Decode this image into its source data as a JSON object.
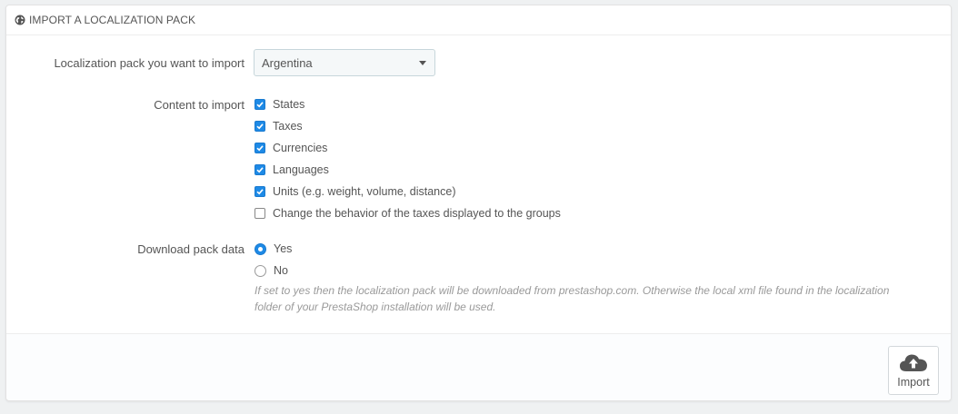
{
  "panel": {
    "title": "IMPORT A LOCALIZATION PACK",
    "icon": "globe-icon"
  },
  "pack_select": {
    "label": "Localization pack you want to import",
    "value": "Argentina"
  },
  "content": {
    "label": "Content to import",
    "items": [
      {
        "label": "States",
        "checked": true
      },
      {
        "label": "Taxes",
        "checked": true
      },
      {
        "label": "Currencies",
        "checked": true
      },
      {
        "label": "Languages",
        "checked": true
      },
      {
        "label": "Units (e.g. weight, volume, distance)",
        "checked": true
      },
      {
        "label": "Change the behavior of the taxes displayed to the groups",
        "checked": false
      }
    ]
  },
  "download": {
    "label": "Download pack data",
    "options": [
      {
        "label": "Yes",
        "selected": true
      },
      {
        "label": "No",
        "selected": false
      }
    ],
    "help_line1": "If set to yes then the localization pack will be downloaded from prestashop.com. Otherwise the local xml file found in the localization",
    "help_line2": "folder of your PrestaShop installation will be used."
  },
  "footer": {
    "import_label": "Import",
    "import_icon": "cloud-upload-icon"
  },
  "colors": {
    "accent": "#1e8ae6",
    "background": "#eff1f2"
  }
}
